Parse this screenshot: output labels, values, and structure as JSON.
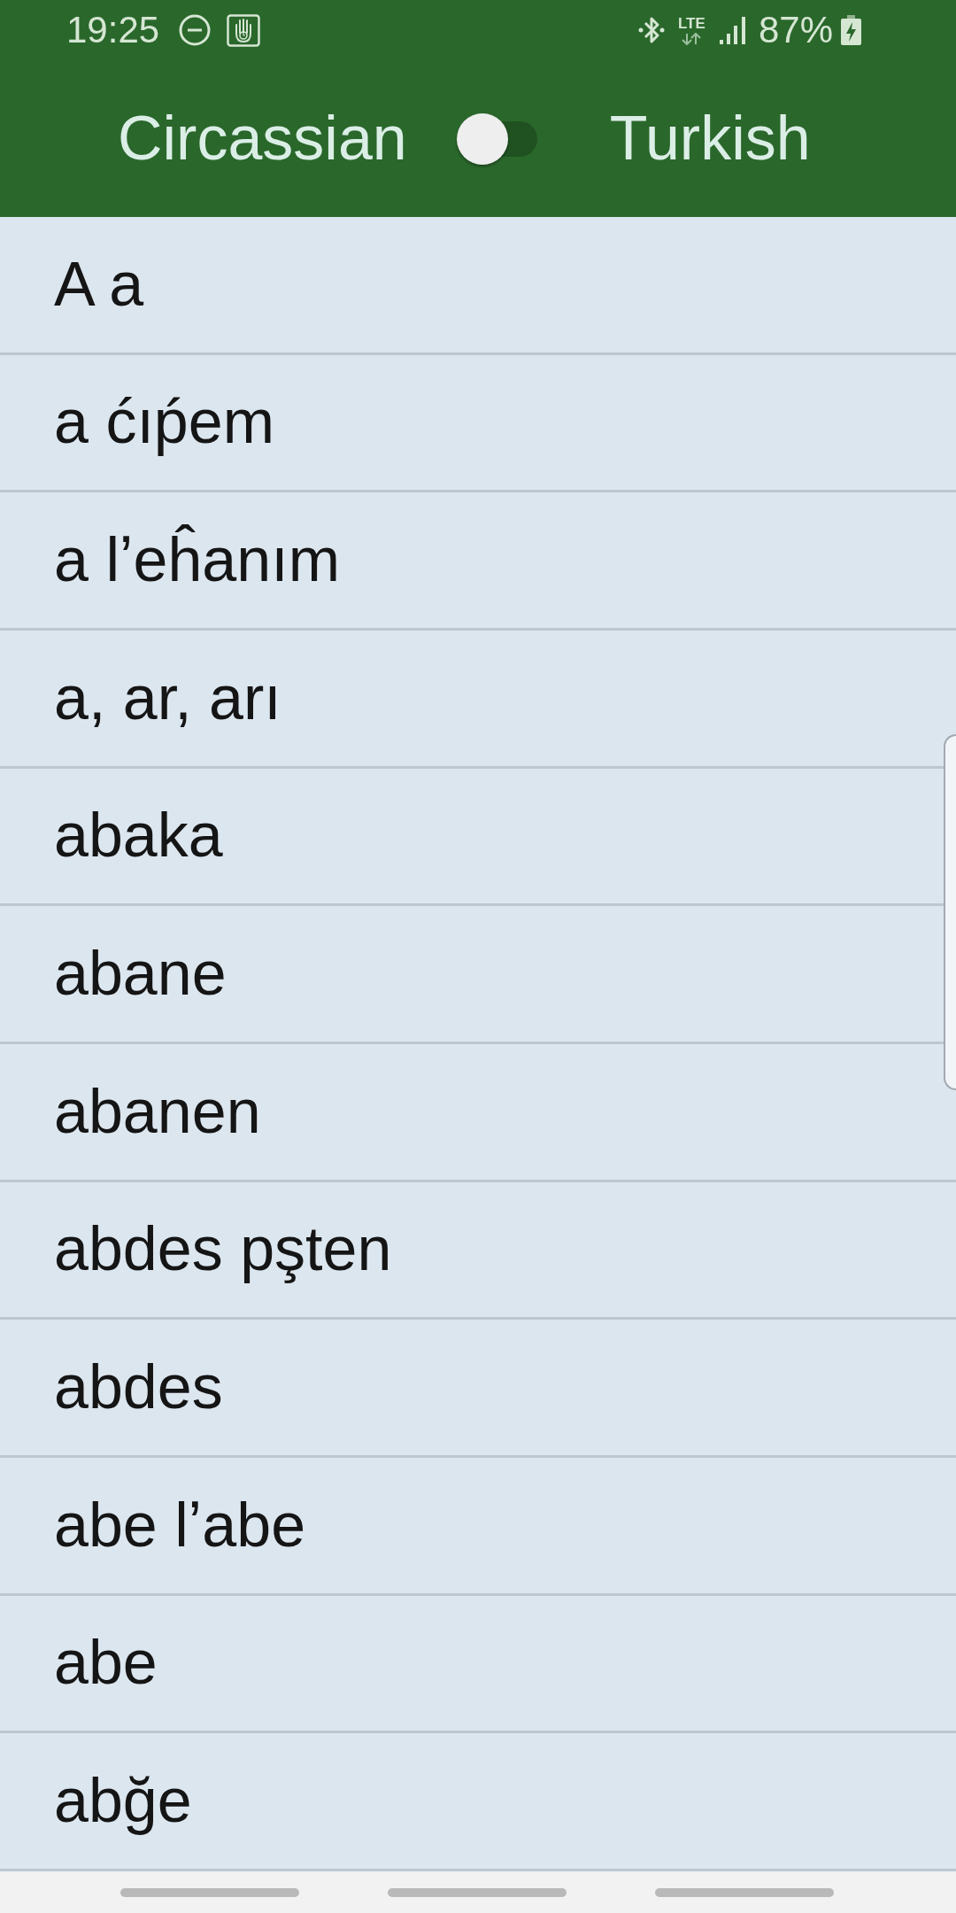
{
  "status_bar": {
    "time": "19:25",
    "network_type": "LTE",
    "battery": "87%"
  },
  "toolbar": {
    "source_language": "Circassian",
    "swap_switch": {
      "on": false
    },
    "target_language": "Turkish"
  },
  "words": [
    "A a",
    "a ćıṕem",
    "a lʼeĥanım",
    "a, ar, arı",
    "abaka",
    "abane",
    "abanen",
    "abdes pşten",
    "abdes",
    "abe lʼabe",
    "abe",
    "abğe"
  ]
}
